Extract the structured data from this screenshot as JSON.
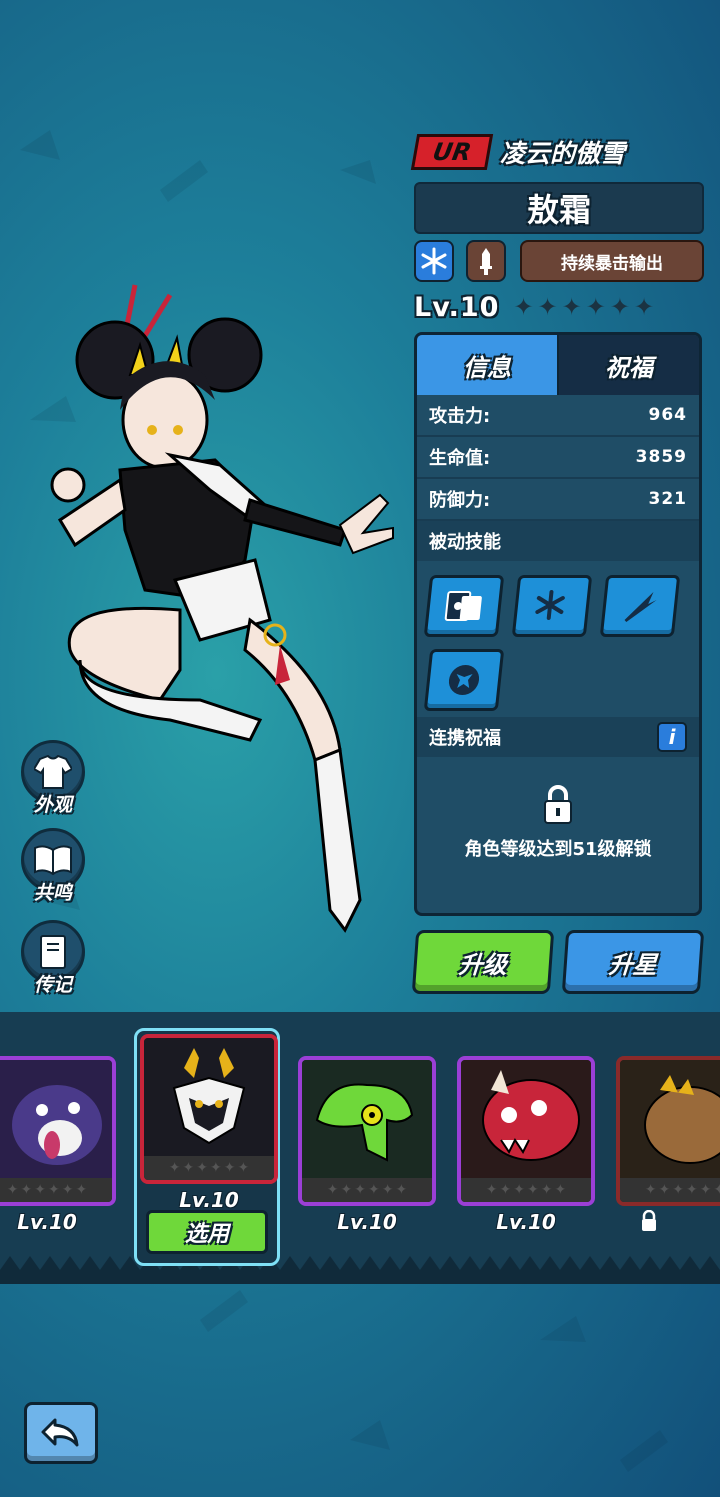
{
  "hero": {
    "rarity": "UR",
    "title": "凌云的傲雪",
    "name": "敖霜",
    "role_tag": "持续暴击输出",
    "level": "Lv.10",
    "star_count": 6,
    "element_icon": "snowflake-icon",
    "class_icon": "sword-icon"
  },
  "side_menu": {
    "appearance": "外观",
    "resonance": "共鸣",
    "biography": "传记"
  },
  "panel": {
    "tabs": [
      "信息",
      "祝福"
    ],
    "stats": [
      {
        "label": "攻击力:",
        "value": "964"
      },
      {
        "label": "生命值:",
        "value": "3859"
      },
      {
        "label": "防御力:",
        "value": "321"
      }
    ],
    "passive_title": "被动技能",
    "passive_skills": [
      "card-skill-icon",
      "snowflake-skill-icon",
      "slash-skill-icon",
      "dragon-skill-icon"
    ],
    "link_title": "连携祝福",
    "lock_text": "角色等级达到51级解锁"
  },
  "actions": {
    "upgrade": "升级",
    "star_up": "升星"
  },
  "roster": {
    "cards": [
      {
        "level": "Lv.10",
        "state": "normal"
      },
      {
        "level": "Lv.10",
        "state": "selected",
        "button": "选用"
      },
      {
        "level": "Lv.10",
        "state": "normal"
      },
      {
        "level": "Lv.10",
        "state": "normal"
      },
      {
        "level": "",
        "state": "locked"
      }
    ]
  },
  "colors": {
    "ur_red": "#d6212a",
    "active_tab": "#3b96e6",
    "upgrade_green": "#6fd83a",
    "star_blue": "#3b96e6"
  }
}
